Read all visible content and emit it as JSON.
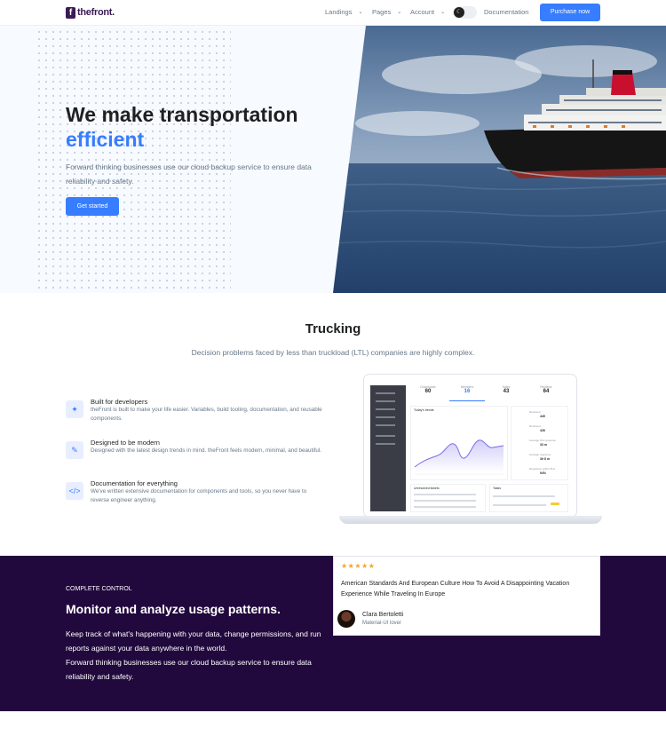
{
  "header": {
    "logo_mark": "f",
    "logo_text": "thefront.",
    "nav": [
      {
        "label": "Landings",
        "has_dropdown": true
      },
      {
        "label": "Pages",
        "has_dropdown": true
      },
      {
        "label": "Account",
        "has_dropdown": true
      }
    ],
    "theme_toggle_icon": "moon-icon",
    "documentation_label": "Documentation",
    "purchase_label": "Purchase now"
  },
  "hero": {
    "title_line1": "We make transportation",
    "title_line2": "efficient",
    "description": "Forward thinking businesses use our cloud backup service to ensure data reliability and safety.",
    "cta_label": "Get started",
    "image": "cruise-ship-photo"
  },
  "trucking": {
    "title": "Trucking",
    "subtitle": "Decision problems faced by less than truckload (LTL) companies are highly complex.",
    "features": [
      {
        "icon": "cursor-click-icon",
        "title": "Built for developers",
        "description": "theFront is built to make your life easier. Variables, build tooling, documentation, and reusable components."
      },
      {
        "icon": "design-icon",
        "title": "Designed to be modern",
        "description": "Designed with the latest design trends in mind. theFront feels modern, minimal, and beautiful."
      },
      {
        "icon": "code-icon",
        "title": "Documentation for everything",
        "description": "We've written extensive documentation for components and tools, so you never have to reverse engineer anything."
      }
    ],
    "mockup": {
      "stats": [
        {
          "label": "Downloads",
          "value": "60"
        },
        {
          "label": "Members",
          "value": "16"
        },
        {
          "label": "Sales",
          "value": "43"
        },
        {
          "label": "Reviews",
          "value": "64"
        }
      ],
      "chart_title": "Today's trends",
      "side_values": [
        {
          "label": "Resolved",
          "value": "449"
        },
        {
          "label": "Received",
          "value": "426"
        },
        {
          "label": "Average first response",
          "value": "33 m"
        },
        {
          "label": "Average response",
          "value": "3h 8 m"
        },
        {
          "label": "Resolution within SLA",
          "value": "94%"
        }
      ],
      "bottom_left_title": "Unresolved tickets",
      "bottom_right_title": "Tasks"
    }
  },
  "control": {
    "eyebrow": "Complete control",
    "title": "Monitor and analyze usage patterns.",
    "paragraph1": "Keep track of what's happening with your data, change permissions, and run reports against your data anywhere in the world.",
    "paragraph2": "Forward thinking businesses use our cloud backup service to ensure data reliability and safety.",
    "review": {
      "stars": "★★★★★",
      "rating": 5,
      "text": "American Standards And European Culture How To Avoid A Disappointing Vacation Experience While Traveling In Europe",
      "name": "Clara Bertoletti",
      "role": "Material-UI lover"
    }
  },
  "colors": {
    "primary": "#377dff",
    "dark_section": "#21083d",
    "logo": "#3b1b55",
    "star": "#f5a623"
  }
}
